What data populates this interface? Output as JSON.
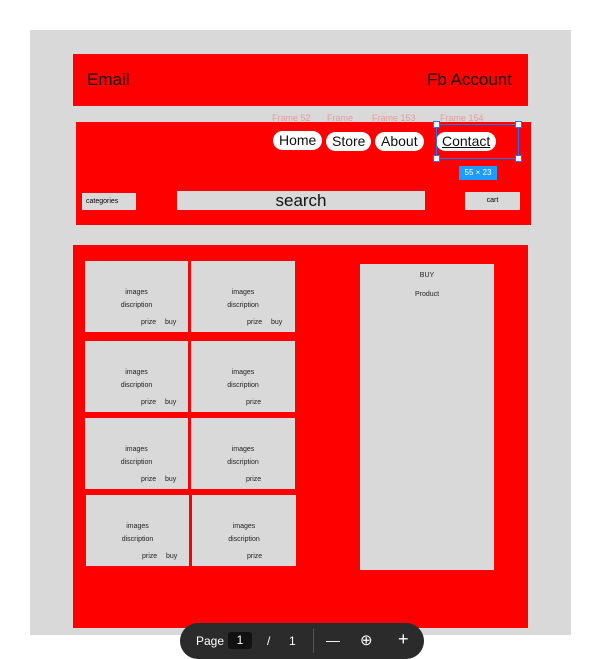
{
  "topbar": {
    "email": "Email",
    "fb_account": "Fb Account"
  },
  "frame_labels": [
    "Frame 52",
    "Frame",
    "Frame 153",
    "Frame 154"
  ],
  "nav": {
    "home": "Home",
    "store": "Store",
    "about": "About",
    "contact": "Contact"
  },
  "selection": {
    "size_label": "55 × 23"
  },
  "search_bar": {
    "categories": "categories",
    "search": "search",
    "cart": "cart"
  },
  "cards": [
    {
      "images": "images",
      "description": "discription",
      "prize": "prize",
      "buy": "buy"
    },
    {
      "images": "images",
      "description": "discription",
      "prize": "prize",
      "buy": "buy"
    },
    {
      "images": "images",
      "description": "discription",
      "prize": "prize",
      "buy": "buy"
    },
    {
      "images": "images",
      "description": "discription",
      "prize": "prize",
      "buy": ""
    },
    {
      "images": "images",
      "description": "discription",
      "prize": "prize",
      "buy": "buy"
    },
    {
      "images": "images",
      "description": "discription",
      "prize": "prize",
      "buy": ""
    },
    {
      "images": "images",
      "description": "discription",
      "prize": "prize",
      "buy": "buy"
    },
    {
      "images": "images",
      "description": "discription",
      "prize": "prize",
      "buy": ""
    }
  ],
  "buy_panel": {
    "title": "BUY",
    "product": "Product"
  },
  "toolbar": {
    "page_label": "Page",
    "current_page": "1",
    "separator": "/",
    "total_pages": "1",
    "zoom_out": "—",
    "zoom_icon": "⊕",
    "zoom_in": "+"
  },
  "colors": {
    "accent": "#ff0000",
    "placeholder": "#d9d9d9",
    "selection": "#1e78ff"
  }
}
